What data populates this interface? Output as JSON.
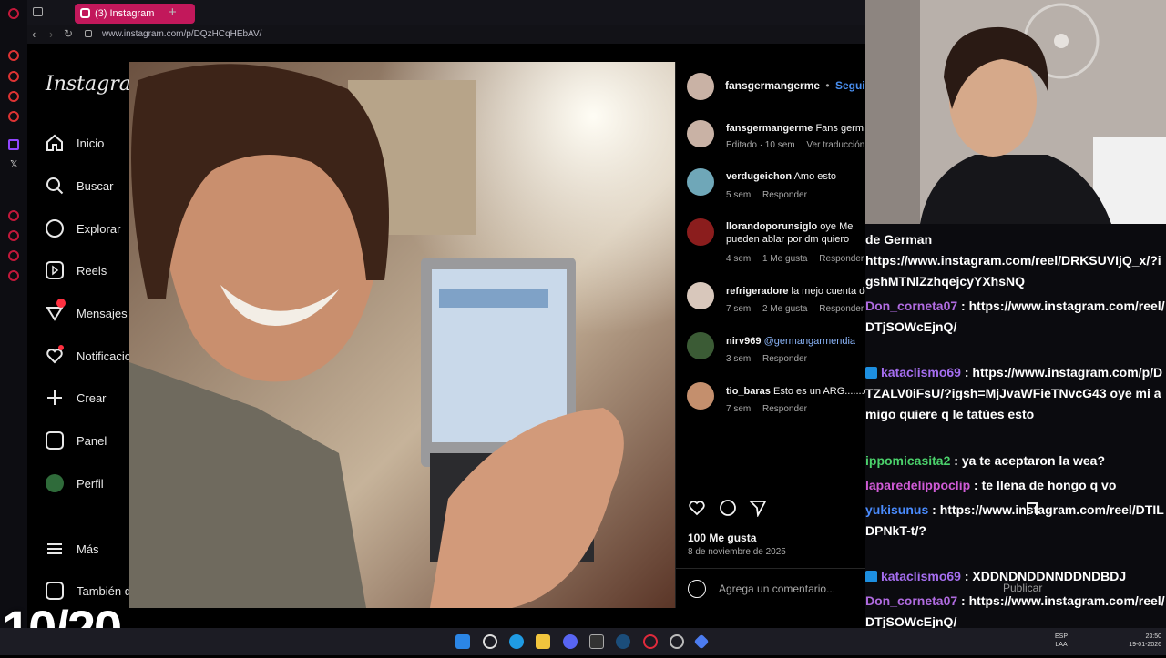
{
  "browser": {
    "tab_title": "(3) Instagram",
    "url": "www.instagram.com/p/DQzHCqHEbAV/"
  },
  "instagram": {
    "logo": "Instagram",
    "nav": [
      {
        "label": "Inicio",
        "icon": "home-icon"
      },
      {
        "label": "Buscar",
        "icon": "search-icon"
      },
      {
        "label": "Explorar",
        "icon": "compass-icon"
      },
      {
        "label": "Reels",
        "icon": "reels-icon"
      },
      {
        "label": "Mensajes",
        "icon": "messenger-icon"
      },
      {
        "label": "Notificaciones",
        "icon": "heart-icon"
      },
      {
        "label": "Crear",
        "icon": "plus-icon"
      },
      {
        "label": "Panel",
        "icon": "chart-icon"
      },
      {
        "label": "Perfil",
        "icon": "avatar-icon"
      },
      {
        "label": "Más",
        "icon": "menu-icon"
      },
      {
        "label": "También de Meta",
        "icon": "grid-icon"
      }
    ],
    "post": {
      "author": "fansgermangerme",
      "separator": "•",
      "follow": "Seguir",
      "caption_user": "fansgermangerme",
      "caption_text": "Fans germ",
      "caption_meta": [
        "Editado · 10 sem",
        "Ver traducción"
      ],
      "likes": "100 Me gusta",
      "date": "8 de noviembre de 2025",
      "comment_placeholder": "Agrega un comentario...",
      "publish": "Publicar"
    },
    "comments": [
      {
        "user": "verdugeichon",
        "text": "Amo esto",
        "meta": [
          "5 sem",
          "Responder"
        ]
      },
      {
        "user": "llorandoporunsiglo",
        "text": "oye Me pueden ablar por dm quiero pedirles un fabor",
        "meta": [
          "4 sem",
          "1 Me gusta",
          "Responder"
        ]
      },
      {
        "user": "refrigeradore",
        "text": "la mejo cuenta de lterne",
        "meta": [
          "7 sem",
          "2 Me gusta",
          "Responder"
        ]
      },
      {
        "user": "nirv969",
        "text": "@germangarmendia",
        "meta": [
          "3 sem",
          "Responder"
        ]
      },
      {
        "user": "tio_baras",
        "text": "Esto es un ARG.......el",
        "meta": [
          "7 sem",
          "Responder"
        ]
      }
    ]
  },
  "chat": [
    {
      "user": "",
      "text": "de German"
    },
    {
      "user": "",
      "text": "https://www.instagram.com/reel/DRKSUVIjQ_x/?igshMTNlZzhqejcyYXhsNQ"
    },
    {
      "user": "Don_corneta07",
      "text": "https://www.instagram.com/reel/DTjSOWcEjnQ/",
      "color": "#b06be0"
    },
    {
      "user": "kataclismo69",
      "text": "https://www.instagram.com/p/DTZALV0iFsU/?igsh=MjJvaWFieTNvcG43 oye mi amigo quiere q le tatúes esto",
      "color": "#a56ef0"
    },
    {
      "user": "ippomicasita2",
      "text": "ya te aceptaron la wea?",
      "color": "#4bd16b"
    },
    {
      "user": "laparedelippoclip",
      "text": "te llena de hongo q vo",
      "color": "#d05bd6"
    },
    {
      "user": "yukisunus",
      "text": "https://www.instagram.com/reel/DTILDPNkT-t/?",
      "color": "#4a8cff"
    },
    {
      "user": "kataclismo69",
      "text": "XDDNDNDDNNDDNDBDJ",
      "color": "#a56ef0"
    },
    {
      "user": "Don_corneta07",
      "text": "https://www.instagram.com/reel/DTjSOWcEjnQ/",
      "color": "#b06be0"
    }
  ],
  "overlay": {
    "counter": "10/20"
  },
  "taskbar": {
    "lang": "ESP",
    "lang2": "LAA",
    "time": "23:50",
    "date": "19-01-2026"
  }
}
